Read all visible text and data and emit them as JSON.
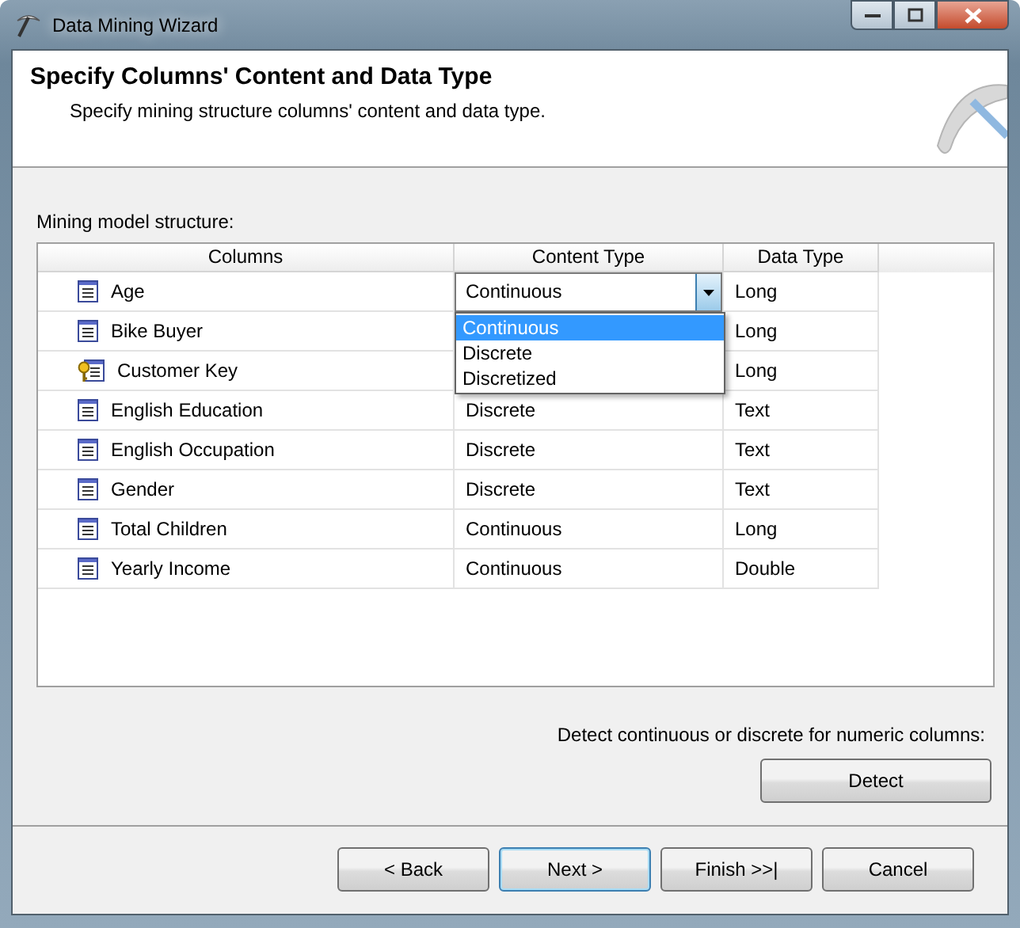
{
  "window": {
    "title": "Data Mining Wizard"
  },
  "header": {
    "title": "Specify Columns' Content and Data Type",
    "subtitle": "Specify mining structure columns' content and data type."
  },
  "grid_label": {
    "text": "Mining model structure:"
  },
  "table": {
    "columns": [
      "Columns",
      "Content Type",
      "Data Type"
    ],
    "rows": [
      {
        "kind": "column",
        "name": "Age",
        "content_type": "Continuous",
        "data_type": "Long",
        "expanded": true,
        "options": [
          {
            "label": "Continuous",
            "selected": true
          },
          {
            "label": "Discrete",
            "selected": false
          },
          {
            "label": "Discretized",
            "selected": false
          }
        ]
      },
      {
        "kind": "column",
        "name": "Bike Buyer",
        "data_type": "Long"
      },
      {
        "kind": "key",
        "name": "Customer Key",
        "data_type": "Long"
      },
      {
        "kind": "column",
        "name": "English Education",
        "content_type": "Discrete",
        "data_type": "Text"
      },
      {
        "kind": "column",
        "name": "English Occupation",
        "content_type": "Discrete",
        "data_type": "Text"
      },
      {
        "kind": "column",
        "name": "Gender",
        "content_type": "Discrete",
        "data_type": "Text"
      },
      {
        "kind": "column",
        "name": "Total Children",
        "content_type": "Continuous",
        "data_type": "Long"
      },
      {
        "kind": "column",
        "name": "Yearly Income",
        "content_type": "Continuous",
        "data_type": "Double"
      }
    ]
  },
  "detect": {
    "hint": "Detect continuous or discrete for numeric columns:",
    "button": {
      "label": "Detect"
    }
  },
  "buttons": [
    {
      "label": "< Back",
      "default": false
    },
    {
      "label": "Next >",
      "default": true
    },
    {
      "label": "Finish >>|",
      "default": false
    },
    {
      "label": "Cancel",
      "default": false
    }
  ]
}
